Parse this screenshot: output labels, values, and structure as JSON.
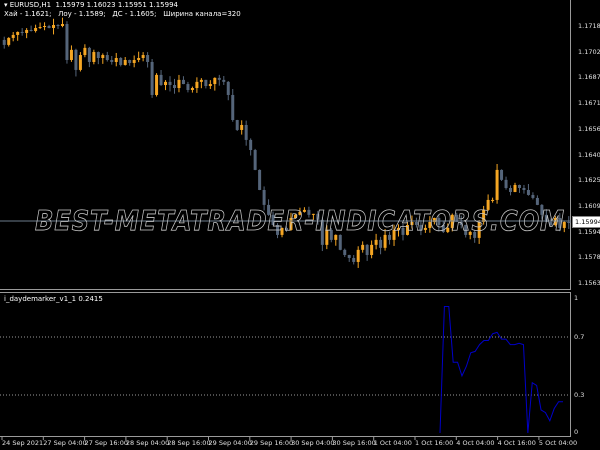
{
  "header": {
    "symbol_line": "EURUSD,H1  1.15979 1.16023 1.15951 1.15994",
    "info_line": "Хай - 1.1621;   Лоу - 1.1589;   ДС - 1.1605;   Ширина канала=320"
  },
  "indicator": {
    "label": "i_daydemarker_v1_1 0.2415",
    "levels": [
      "1",
      "0.7",
      "0.3",
      "0"
    ],
    "line_color": "#0000c8",
    "values": [
      0,
      0.93,
      0.93,
      0.52,
      0.52,
      0.42,
      0.49,
      0.59,
      0.6,
      0.65,
      0.68,
      0.68,
      0.73,
      0.74,
      0.69,
      0.69,
      0.65,
      0.65,
      0.66,
      0.65,
      0,
      0.37,
      0.35,
      0.17,
      0.15,
      0.09,
      0.18,
      0.23,
      0.23
    ]
  },
  "watermark": "BEST-METATRADER-INDICATORS.COM",
  "colors": {
    "bull": "#f5a623",
    "bear": "#55657a",
    "background": "#000000",
    "price_line": "#6b7b8c"
  },
  "current_price": "1.15994",
  "chart_data": {
    "type": "candlestick",
    "symbol": "EURUSD",
    "timeframe": "H1",
    "y_ticks": [
      "1.17180",
      "1.17025",
      "1.16870",
      "1.16715",
      "1.16560",
      "1.16405",
      "1.16250",
      "1.16095",
      "1.15940",
      "1.15785",
      "1.15630"
    ],
    "x_ticks": [
      "24 Sep 2021",
      "27 Sep 04:00",
      "27 Sep 16:00",
      "28 Sep 04:00",
      "28 Sep 16:00",
      "29 Sep 04:00",
      "29 Sep 16:00",
      "30 Sep 04:00",
      "30 Sep 16:00",
      "1 Oct 04:00",
      "1 Oct 16:00",
      "4 Oct 04:00",
      "4 Oct 16:00",
      "5 Oct 04:00"
    ],
    "closes": [
      1.17066,
      1.17108,
      1.17126,
      1.17144,
      1.17138,
      1.17156,
      1.1715,
      1.17168,
      1.17174,
      1.1718,
      1.17168,
      1.17186,
      1.1718,
      1.17192,
      1.16975,
      1.17036,
      1.16915,
      1.17005,
      1.17048,
      1.16963,
      1.17023,
      1.16987,
      1.17005,
      1.16975,
      1.16963,
      1.16987,
      1.16945,
      1.16975,
      1.16957,
      1.16975,
      1.16987,
      1.17005,
      1.16963,
      1.16764,
      1.16885,
      1.16824,
      1.16843,
      1.16824,
      1.16806,
      1.16855,
      1.1683,
      1.16794,
      1.16806,
      1.16843,
      1.16855,
      1.16818,
      1.1683,
      1.16867,
      1.16855,
      1.16843,
      1.16764,
      1.16613,
      1.16553,
      1.16583,
      1.16493,
      1.16432,
      1.16312,
      1.16191,
      1.16101,
      1.16041,
      1.1598,
      1.1592,
      1.15962,
      1.1595,
      1.16022,
      1.16041,
      1.16059,
      1.16071,
      1.16041,
      1.16047,
      1.16011,
      1.1586,
      1.1595,
      1.1589,
      1.1592,
      1.1583,
      1.15799,
      1.15781,
      1.15757,
      1.1583,
      1.1586,
      1.15799,
      1.1586,
      1.1589,
      1.15842,
      1.1592,
      1.1589,
      1.1595,
      1.15962,
      1.1592,
      1.1598,
      1.15998,
      1.1598,
      1.1595,
      1.15962,
      1.15998,
      1.16022,
      1.1598,
      1.15938,
      1.15962,
      1.16041,
      1.15998,
      1.1598,
      1.1592,
      1.15938,
      1.15902,
      1.15998,
      1.16071,
      1.16131,
      1.16131,
      1.16312,
      1.16252,
      1.16203,
      1.16179,
      1.16221,
      1.16203,
      1.16191,
      1.16161,
      1.16143,
      1.16101,
      1.16041,
      1.15998,
      1.1598,
      1.16022,
      1.15962,
      1.15998,
      1.15994
    ],
    "ylim": [
      1.1551,
      1.1734
    ],
    "indicator_ylim": [
      0,
      1
    ]
  }
}
